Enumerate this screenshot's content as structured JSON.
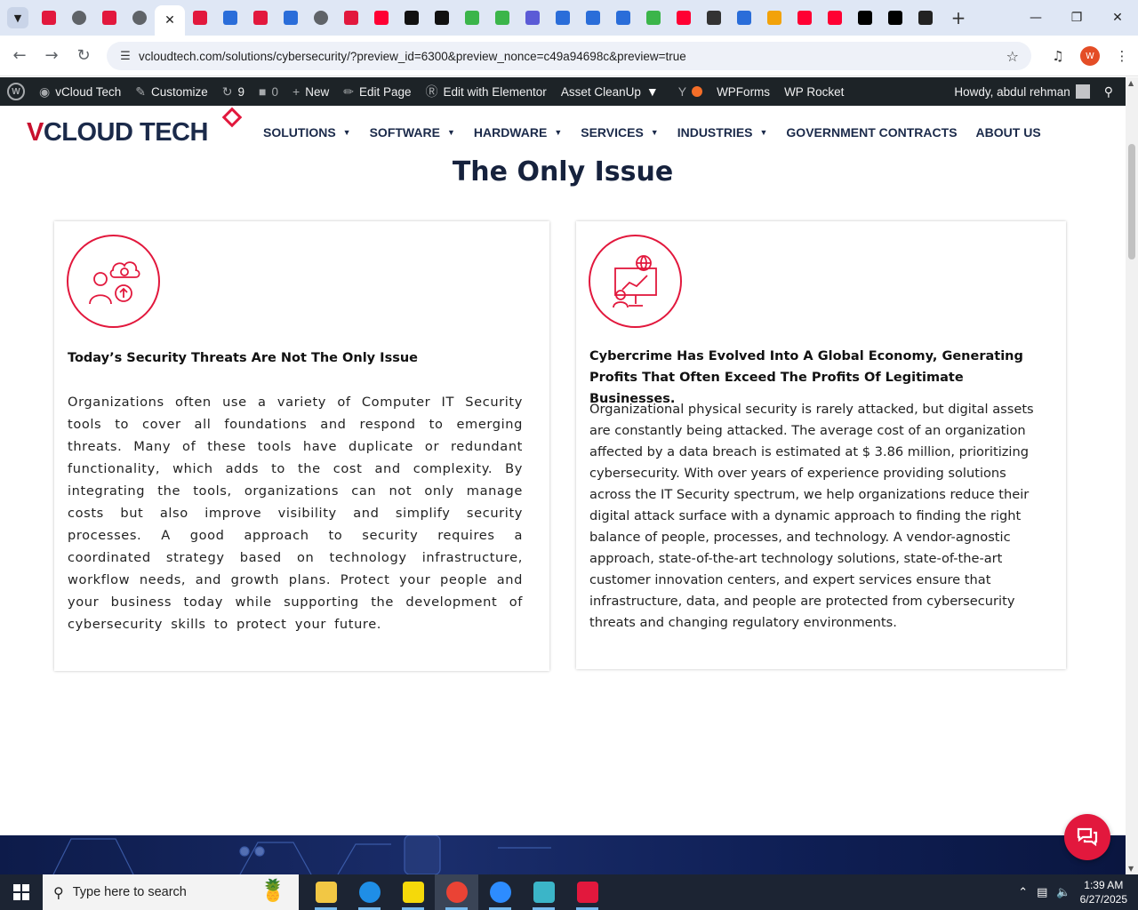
{
  "browser": {
    "tab_count_icons": [
      {
        "icon": "red-diamond-icon",
        "color": "#e2183d"
      },
      {
        "icon": "globe-icon",
        "color": "#5f6368"
      },
      {
        "icon": "red-diamond-icon",
        "color": "#e2183d"
      },
      {
        "icon": "globe-icon",
        "color": "#5f6368"
      },
      {
        "icon": "close-icon",
        "active": true
      },
      {
        "icon": "red-diamond-icon",
        "color": "#e2183d"
      },
      {
        "icon": "bird-icon",
        "color": "#2a6dd9"
      },
      {
        "icon": "red-diamond-icon",
        "color": "#e2183d"
      },
      {
        "icon": "text-tool-icon",
        "color": "#2a6dd9"
      },
      {
        "icon": "globe-icon",
        "color": "#5f6368"
      },
      {
        "icon": "red-diamond-icon",
        "color": "#e2183d"
      },
      {
        "icon": "youtube-icon",
        "color": "#ff0033"
      },
      {
        "icon": "chatgpt-icon",
        "color": "#111111"
      },
      {
        "icon": "chatgpt-icon",
        "color": "#111111"
      },
      {
        "icon": "green-leaf-icon",
        "color": "#3bb54a"
      },
      {
        "icon": "green-leaf-icon",
        "color": "#3bb54a"
      },
      {
        "icon": "purple-swirl-icon",
        "color": "#5b5bd6"
      },
      {
        "icon": "text-tool-icon",
        "color": "#2a6dd9"
      },
      {
        "icon": "grid-icon",
        "color": "#2a6dd9"
      },
      {
        "icon": "grid-icon",
        "color": "#2a6dd9"
      },
      {
        "icon": "green-leaf-icon",
        "color": "#3bb54a"
      },
      {
        "icon": "youtube-icon",
        "color": "#ff0033"
      },
      {
        "icon": "lock-icon",
        "color": "#333333"
      },
      {
        "icon": "arc-icon",
        "color": "#2a6dd9"
      },
      {
        "icon": "ring-icon",
        "color": "#f2a20a"
      },
      {
        "icon": "youtube-icon",
        "color": "#ff0033"
      },
      {
        "icon": "youtube-icon",
        "color": "#ff0033"
      },
      {
        "icon": "x-icon",
        "color": "#000000"
      },
      {
        "icon": "x-icon",
        "color": "#000000"
      },
      {
        "icon": "dark-square-icon",
        "color": "#222222"
      }
    ],
    "url": "vcloudtech.com/solutions/cybersecurity/?preview_id=6300&preview_nonce=c49a94698c&preview=true",
    "profile_initial": "W"
  },
  "wpbar": {
    "site_name": "vCloud Tech",
    "customize": "Customize",
    "updates_count": "9",
    "comments_count": "0",
    "new_label": "New",
    "edit_page": "Edit Page",
    "elementor": "Edit with Elementor",
    "asset_cleanup": "Asset CleanUp",
    "wpforms": "WPForms",
    "wp_rocket": "WP Rocket",
    "howdy": "Howdy, abdul rehman"
  },
  "site": {
    "logo_v": "V",
    "logo_rest": "CLOUD TECH",
    "nav": [
      {
        "label": "SOLUTIONS",
        "dropdown": true
      },
      {
        "label": "SOFTWARE",
        "dropdown": true
      },
      {
        "label": "HARDWARE",
        "dropdown": true
      },
      {
        "label": "SERVICES",
        "dropdown": true
      },
      {
        "label": "INDUSTRIES",
        "dropdown": true
      },
      {
        "label": "GOVERNMENT CONTRACTS",
        "dropdown": false
      },
      {
        "label": "ABOUT US",
        "dropdown": false
      }
    ]
  },
  "content": {
    "section_title": "The Only Issue",
    "cards": [
      {
        "icon": "person-cloud-gear-icon",
        "title": "Today’s Security Threats Are Not The Only Issue",
        "body": "Organizations often use a variety of Computer IT Security tools to cover all foundations and respond to emerging threats. Many of these tools have duplicate or redundant functionality, which adds to the cost and complexity. By integrating the tools, organizations can not only manage costs but also improve visibility and simplify security processes. A good approach to security requires a coordinated strategy based on technology infrastructure, workflow needs, and growth plans. Protect your people and your business today while supporting the development of cybersecurity skills to protect your future."
      },
      {
        "icon": "presentation-chart-globe-icon",
        "title": "Cybercrime Has Evolved Into A Global Economy, Generating Profits That Often Exceed The Profits Of Legitimate Businesses.",
        "body": "Organizational physical security is rarely attacked, but digital assets are constantly being attacked. The average cost of an organization affected by a data breach is estimated at $ 3.86 million, prioritizing cybersecurity. With over years of experience providing solutions across the IT Security spectrum, we help organizations reduce their digital attack surface with a dynamic approach to finding the right balance of people, processes, and technology. A vendor-agnostic approach, state-of-the-art technology solutions, state-of-the-art customer innovation centers, and expert services ensure that infrastructure, data, and people are protected from cybersecurity threats and changing regulatory environments."
      }
    ]
  },
  "taskbar": {
    "search_placeholder": "Type here to search",
    "apps": [
      {
        "icon": "file-explorer-icon",
        "color": "#f2c744"
      },
      {
        "icon": "edge-icon",
        "color": "#1f8ee6"
      },
      {
        "icon": "sticky-notes-icon",
        "color": "#f5d90a"
      },
      {
        "icon": "chrome-icon",
        "color": "#ea4335",
        "active": true
      },
      {
        "icon": "zoom-icon",
        "color": "#2d8cff"
      },
      {
        "icon": "diamond-app-icon",
        "color": "#3bb5c8"
      },
      {
        "icon": "snipping-tool-icon",
        "color": "#e2183d"
      }
    ],
    "time": "1:39 AM",
    "date": "6/27/2025"
  },
  "colors": {
    "accent_red": "#e2183d",
    "navy": "#1b2a4a",
    "wpbar_bg": "#1d2327"
  }
}
